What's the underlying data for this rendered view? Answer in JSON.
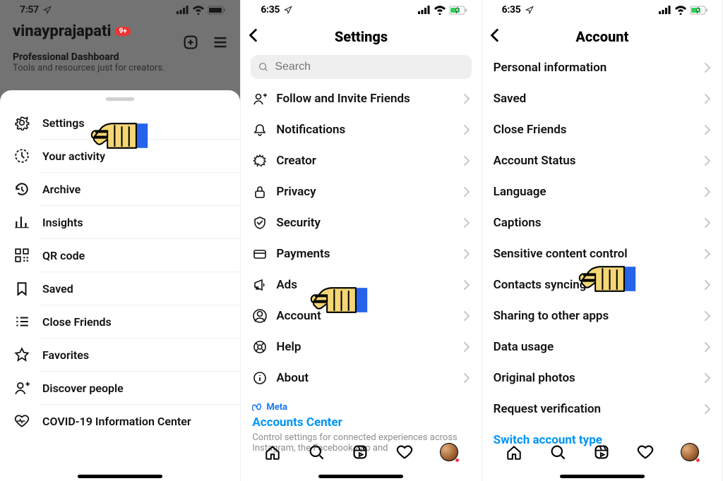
{
  "panel1": {
    "time": "7:57",
    "username": "vinayprajapati",
    "badge": "9+",
    "dashboard_title": "Professional Dashboard",
    "dashboard_subtitle": "Tools and resources just for creators.",
    "menu": {
      "settings": "Settings",
      "activity": "Your activity",
      "archive": "Archive",
      "insights": "Insights",
      "qr": "QR code",
      "saved": "Saved",
      "close_friends": "Close Friends",
      "favorites": "Favorites",
      "discover": "Discover people",
      "covid": "COVID-19 Information Center"
    }
  },
  "panel2": {
    "time": "6:35",
    "title": "Settings",
    "search_placeholder": "Search",
    "items": {
      "follow": "Follow and Invite Friends",
      "notifications": "Notifications",
      "creator": "Creator",
      "privacy": "Privacy",
      "security": "Security",
      "payments": "Payments",
      "ads": "Ads",
      "account": "Account",
      "help": "Help",
      "about": "About"
    },
    "meta_brand": "Meta",
    "accounts_center": "Accounts Center",
    "accounts_desc": "Control settings for connected experiences across Instagram, the Facebook app and"
  },
  "panel3": {
    "time": "6:35",
    "title": "Account",
    "items": {
      "personal": "Personal information",
      "saved": "Saved",
      "close_friends": "Close Friends",
      "status": "Account Status",
      "language": "Language",
      "captions": "Captions",
      "sensitive": "Sensitive content control",
      "contacts": "Contacts syncing",
      "sharing": "Sharing to other apps",
      "data": "Data usage",
      "original": "Original photos",
      "verify": "Request verification"
    },
    "switch": "Switch account type"
  }
}
